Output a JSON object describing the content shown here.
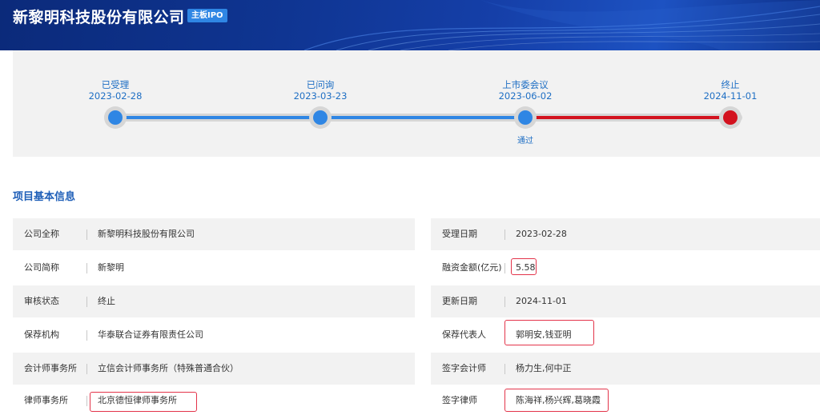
{
  "header": {
    "company_title": "新黎明科技股份有限公司",
    "board_badge": "主板IPO"
  },
  "progress": {
    "steps": [
      {
        "label": "已受理",
        "date": "2023-02-28",
        "note": "",
        "color": "#2f86e4"
      },
      {
        "label": "已问询",
        "date": "2023-03-23",
        "note": "",
        "color": "#2f86e4"
      },
      {
        "label": "上市委会议",
        "date": "2023-06-02",
        "note": "通过",
        "color": "#2f86e4"
      },
      {
        "label": "终止",
        "date": "2024-11-01",
        "note": "",
        "color": "#d3121f"
      }
    ]
  },
  "section": {
    "title": "项目基本信息"
  },
  "info": {
    "left": [
      {
        "key": "公司全称",
        "value": "新黎明科技股份有限公司"
      },
      {
        "key": "公司简称",
        "value": "新黎明"
      },
      {
        "key": "审核状态",
        "value": "终止"
      },
      {
        "key": "保荐机构",
        "value": "华泰联合证券有限责任公司"
      },
      {
        "key": "会计师事务所",
        "value": "立信会计师事务所（特殊普通合伙）"
      },
      {
        "key": "律师事务所",
        "value": "北京德恒律师事务所"
      }
    ],
    "right": [
      {
        "key": "受理日期",
        "value": "2023-02-28"
      },
      {
        "key": "融资金额(亿元)",
        "value": "5.58"
      },
      {
        "key": "更新日期",
        "value": "2024-11-01"
      },
      {
        "key": "保荐代表人",
        "value": "郭明安,钱亚明"
      },
      {
        "key": "签字会计师",
        "value": "杨力生,何中正"
      },
      {
        "key": "签字律师",
        "value": "陈海祥,杨兴辉,葛晓霞"
      }
    ]
  },
  "colors": {
    "accent_blue": "#2f86e4",
    "terminated_red": "#d3121f",
    "highlight_box": "#e3344a"
  }
}
